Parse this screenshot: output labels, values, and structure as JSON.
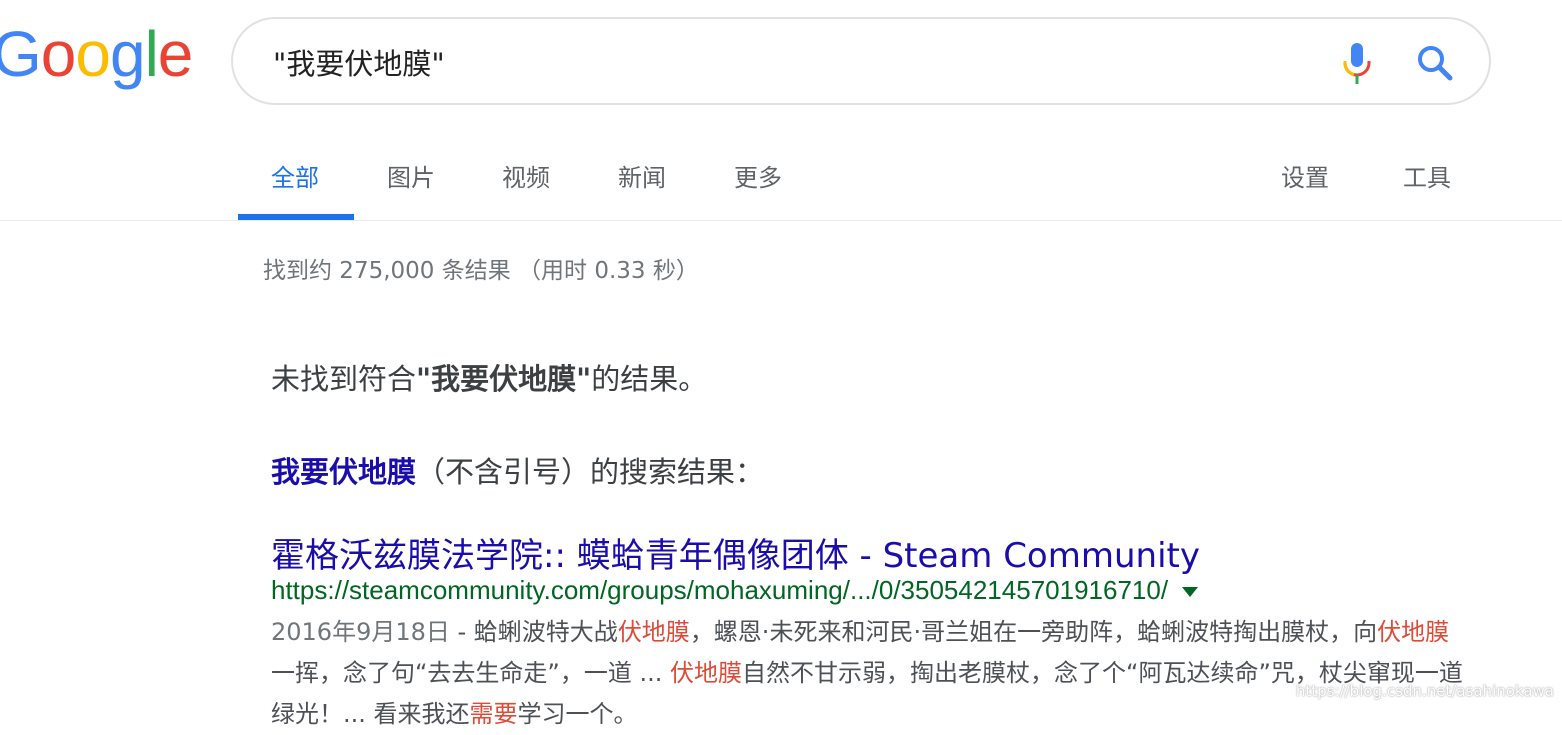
{
  "logo": {
    "letters": [
      "G",
      "o",
      "o",
      "g",
      "l",
      "e"
    ],
    "colors": [
      "#4285F4",
      "#EA4335",
      "#FBBC05",
      "#4285F4",
      "#34A853",
      "#EA4335"
    ]
  },
  "search": {
    "query": "\"我要伏地膜\""
  },
  "tabs": [
    {
      "label": "全部",
      "active": true
    },
    {
      "label": "图片"
    },
    {
      "label": "视频"
    },
    {
      "label": "新闻"
    },
    {
      "label": "更多"
    }
  ],
  "tools": {
    "settings": "设置",
    "tools": "工具"
  },
  "stats": "找到约 275,000 条结果 （用时 0.33 秒）",
  "no_results": {
    "prefix": "未找到符合",
    "query": "\"我要伏地膜\"",
    "suffix": "的结果。"
  },
  "without_quotes": {
    "link": "我要伏地膜",
    "rest": "（不含引号）的搜索结果："
  },
  "result": {
    "title": "霍格沃兹膜法学院:: 蟆蛤青年偶像团体 - Steam Community",
    "url": "https://steamcommunity.com/groups/mohaxuming/.../0/350542145701916710/",
    "date": "2016年9月18日",
    "snippet_parts": [
      {
        "text": " - 蛤蜊波特大战"
      },
      {
        "text": "伏地膜",
        "em": true
      },
      {
        "text": "，螺恩·未死来和河民·哥兰姐在一旁助阵，蛤蜊波特掏出膜杖，向"
      },
      {
        "text": "伏地膜",
        "em": true
      },
      {
        "text": "一挥，念了句“去去生命走”，一道 ... "
      },
      {
        "text": "伏地膜",
        "em": true
      },
      {
        "text": "自然不甘示弱，掏出老膜杖，念了个“阿瓦达续命”咒，杖尖窜现一道绿光！... 看来我还"
      },
      {
        "text": "需要",
        "em": true
      },
      {
        "text": "学习一个。"
      }
    ]
  },
  "watermark": "https://blog.csdn.net/asahinokawa"
}
